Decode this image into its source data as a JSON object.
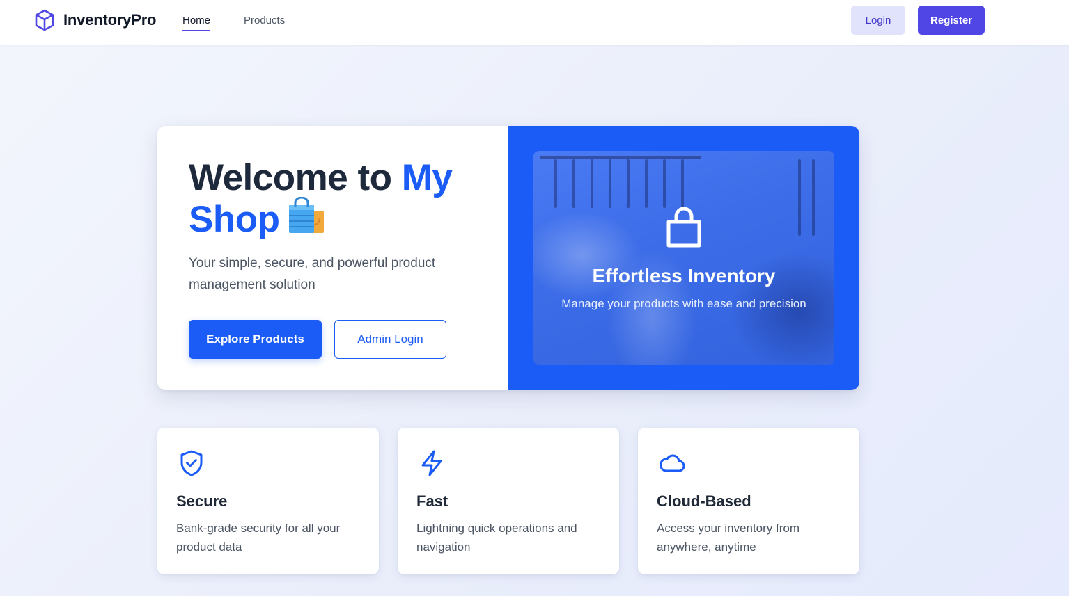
{
  "nav": {
    "brand": "InventoryPro",
    "links": [
      {
        "label": "Home",
        "active": true
      },
      {
        "label": "Products",
        "active": false
      }
    ],
    "login_label": "Login",
    "register_label": "Register",
    "icons": {
      "brand": "cube-icon"
    }
  },
  "hero": {
    "title_part1": "Welcome to ",
    "title_accent": "My Shop",
    "title_emoji": "shopping-bags-icon",
    "subtitle": "Your simple, secure, and powerful product management solution",
    "explore_label": "Explore Products",
    "admin_label": "Admin Login",
    "panel": {
      "icon": "shopping-bag-icon",
      "title": "Effortless Inventory",
      "subtitle": "Manage your products with ease and precision"
    }
  },
  "features": [
    {
      "icon": "shield-check-icon",
      "title": "Secure",
      "desc": "Bank-grade security for all your product data"
    },
    {
      "icon": "lightning-icon",
      "title": "Fast",
      "desc": "Lightning quick operations and navigation"
    },
    {
      "icon": "cloud-icon",
      "title": "Cloud-Based",
      "desc": "Access your inventory from anywhere, anytime"
    }
  ],
  "colors": {
    "primary": "#1a5cf5",
    "brand_indigo": "#4f46e5",
    "login_bg": "#e0e3fb",
    "text_dark": "#1e293b",
    "text_muted": "#4b5563"
  }
}
